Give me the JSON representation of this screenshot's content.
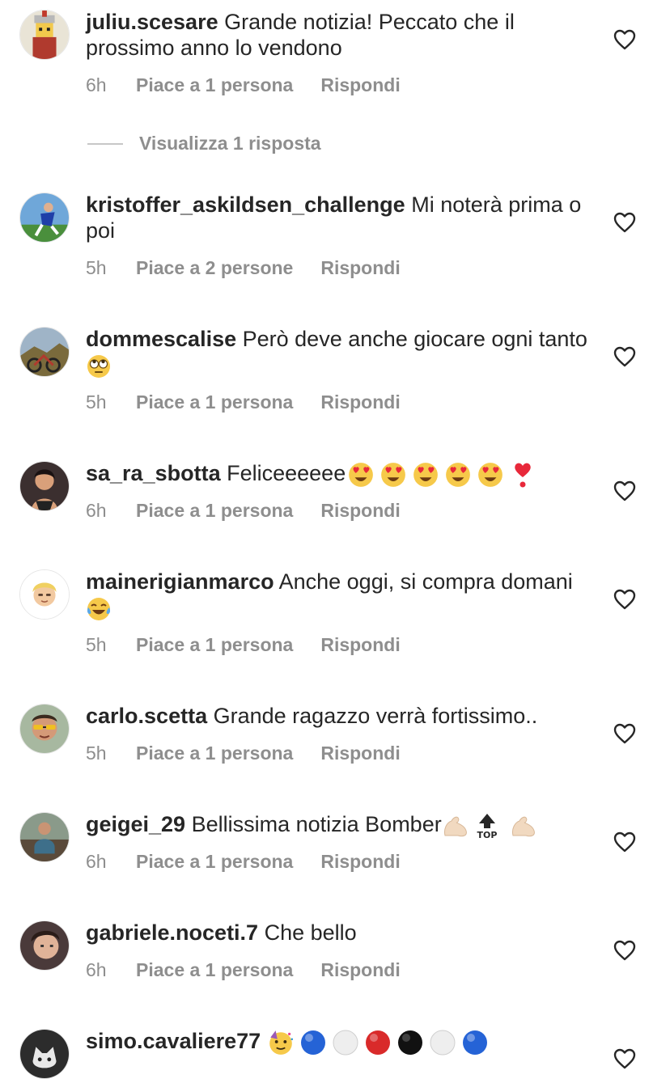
{
  "labels": {
    "reply": "Rispondi",
    "view_replies": "Visualizza 1 risposta"
  },
  "colors": {
    "text": "#262626",
    "muted": "#8e8e8e"
  },
  "comments": [
    {
      "username": "juliu.scesare",
      "text": "Grande notizia! Peccato che il prossimo anno lo vendono",
      "time": "6h",
      "likes": "Piace a 1 persona",
      "avatar": "lego-roman-avatar"
    },
    {
      "username": "kristoffer_askildsen_challenge",
      "text": "Mi noterà prima o poi",
      "time": "5h",
      "likes": "Piace a 2 persone",
      "avatar": "footballer-avatar"
    },
    {
      "username": "dommescalise",
      "text": "Però deve anche giocare ogni tanto",
      "emojis": [
        "eye-roll-emoji"
      ],
      "time": "5h",
      "likes": "Piace a 1 persona",
      "avatar": "bike-mountain-avatar"
    },
    {
      "username": "sa_ra_sbotta",
      "text": "Feliceeeeee",
      "emojis": [
        "heart-eyes-emoji",
        "heart-eyes-emoji",
        "heart-eyes-emoji",
        "heart-eyes-emoji",
        "heart-eyes-emoji",
        "heart-exclamation-emoji"
      ],
      "time": "6h",
      "likes": "Piace a 1 persona",
      "avatar": "woman-avatar"
    },
    {
      "username": "mainerigianmarco",
      "text": "Anche oggi, si compra domani",
      "emojis": [
        "tears-of-joy-emoji"
      ],
      "time": "5h",
      "likes": "Piace a 1 persona",
      "avatar": "memoji-avatar"
    },
    {
      "username": "carlo.scetta",
      "text": "Grande ragazzo verrà fortissimo..",
      "time": "5h",
      "likes": "Piace a 1 persona",
      "avatar": "man-sunglasses-avatar"
    },
    {
      "username": "geigei_29",
      "text": "Bellissima notizia Bomber",
      "emojis": [
        "flexed-biceps-emoji",
        "top-arrow-emoji",
        "flexed-biceps-emoji"
      ],
      "time": "6h",
      "likes": "Piace a 1 persona",
      "avatar": "man-sitting-avatar"
    },
    {
      "username": "gabriele.noceti.7",
      "text": "Che bello",
      "time": "6h",
      "likes": "Piace a 1 persona",
      "avatar": "young-man-avatar"
    },
    {
      "username": "simo.cavaliere77",
      "text": "",
      "emojis": [
        "party-face-emoji",
        "blue-circle-emoji",
        "white-circle-emoji",
        "red-circle-emoji",
        "black-circle-emoji",
        "white-circle-emoji",
        "blue-circle-emoji"
      ],
      "time": "",
      "likes": "",
      "avatar": "cat-avatar"
    }
  ]
}
